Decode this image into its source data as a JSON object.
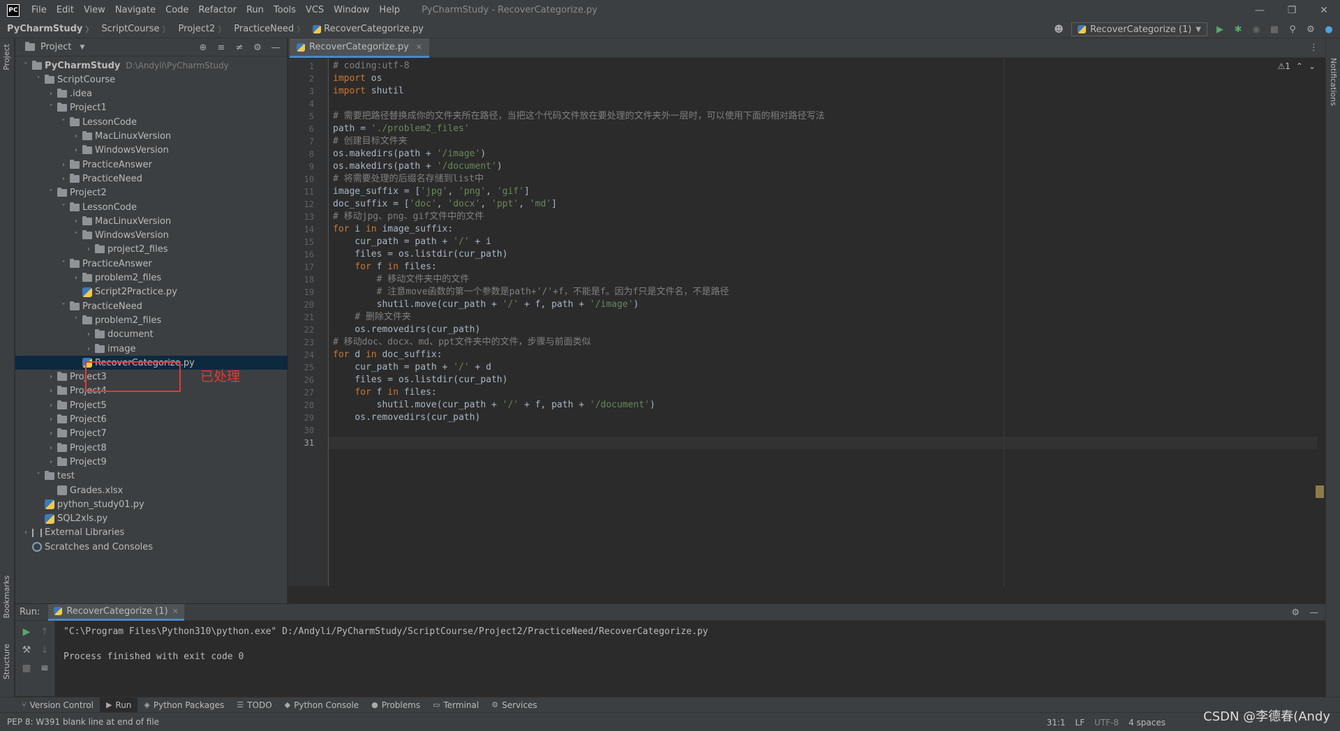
{
  "window": {
    "logo": "PC",
    "title": "PyCharmStudy - RecoverCategorize.py",
    "menu": [
      "File",
      "Edit",
      "View",
      "Navigate",
      "Code",
      "Refactor",
      "Run",
      "Tools",
      "VCS",
      "Window",
      "Help"
    ]
  },
  "breadcrumb": [
    "PyCharmStudy",
    "ScriptCourse",
    "Project2",
    "PracticeNeed",
    "RecoverCategorize.py"
  ],
  "run_config": "RecoverCategorize (1)",
  "stripes": {
    "project": "Project",
    "bookmarks": "Bookmarks",
    "structure": "Structure",
    "notifications": "Notifications"
  },
  "project_panel": {
    "title": "Project",
    "tree": [
      {
        "label": "PyCharmStudy",
        "hint": "D:\\Andyli\\PyCharmStudy",
        "depth": 0,
        "arrow": "open",
        "icon": "folder"
      },
      {
        "label": "ScriptCourse",
        "depth": 1,
        "arrow": "open",
        "icon": "folder"
      },
      {
        "label": ".idea",
        "depth": 2,
        "arrow": "closed",
        "icon": "folder"
      },
      {
        "label": "Project1",
        "depth": 2,
        "arrow": "open",
        "icon": "folder"
      },
      {
        "label": "LessonCode",
        "depth": 3,
        "arrow": "open",
        "icon": "folder"
      },
      {
        "label": "MacLinuxVersion",
        "depth": 4,
        "arrow": "closed",
        "icon": "folder"
      },
      {
        "label": "WindowsVersion",
        "depth": 4,
        "arrow": "closed",
        "icon": "folder"
      },
      {
        "label": "PracticeAnswer",
        "depth": 3,
        "arrow": "closed",
        "icon": "folder"
      },
      {
        "label": "PracticeNeed",
        "depth": 3,
        "arrow": "closed",
        "icon": "folder"
      },
      {
        "label": "Project2",
        "depth": 2,
        "arrow": "open",
        "icon": "folder"
      },
      {
        "label": "LessonCode",
        "depth": 3,
        "arrow": "open",
        "icon": "folder"
      },
      {
        "label": "MacLinuxVersion",
        "depth": 4,
        "arrow": "closed",
        "icon": "folder"
      },
      {
        "label": "WindowsVersion",
        "depth": 4,
        "arrow": "open",
        "icon": "folder"
      },
      {
        "label": "project2_files",
        "depth": 5,
        "arrow": "closed",
        "icon": "folder"
      },
      {
        "label": "PracticeAnswer",
        "depth": 3,
        "arrow": "open",
        "icon": "folder"
      },
      {
        "label": "problem2_files",
        "depth": 4,
        "arrow": "closed",
        "icon": "folder"
      },
      {
        "label": "Script2Practice.py",
        "depth": 4,
        "arrow": "none",
        "icon": "py"
      },
      {
        "label": "PracticeNeed",
        "depth": 3,
        "arrow": "open",
        "icon": "folder"
      },
      {
        "label": "problem2_files",
        "depth": 4,
        "arrow": "open",
        "icon": "folder"
      },
      {
        "label": "document",
        "depth": 5,
        "arrow": "closed",
        "icon": "folder"
      },
      {
        "label": "image",
        "depth": 5,
        "arrow": "closed",
        "icon": "folder"
      },
      {
        "label": "RecoverCategorize.py",
        "depth": 4,
        "arrow": "none",
        "icon": "py",
        "selected": true
      },
      {
        "label": "Project3",
        "depth": 2,
        "arrow": "closed",
        "icon": "folder"
      },
      {
        "label": "Project4",
        "depth": 2,
        "arrow": "closed",
        "icon": "folder"
      },
      {
        "label": "Project5",
        "depth": 2,
        "arrow": "closed",
        "icon": "folder"
      },
      {
        "label": "Project6",
        "depth": 2,
        "arrow": "closed",
        "icon": "folder"
      },
      {
        "label": "Project7",
        "depth": 2,
        "arrow": "closed",
        "icon": "folder"
      },
      {
        "label": "Project8",
        "depth": 2,
        "arrow": "closed",
        "icon": "folder"
      },
      {
        "label": "Project9",
        "depth": 2,
        "arrow": "closed",
        "icon": "folder"
      },
      {
        "label": "test",
        "depth": 1,
        "arrow": "open",
        "icon": "folder"
      },
      {
        "label": "Grades.xlsx",
        "depth": 2,
        "arrow": "none",
        "icon": "xls"
      },
      {
        "label": "python_study01.py",
        "depth": 1,
        "arrow": "none",
        "icon": "py"
      },
      {
        "label": "SQL2xls.py",
        "depth": 1,
        "arrow": "none",
        "icon": "py"
      },
      {
        "label": "External Libraries",
        "depth": 0,
        "arrow": "closed",
        "icon": "lib"
      },
      {
        "label": "Scratches and Consoles",
        "depth": 0,
        "arrow": "none",
        "icon": "scratch"
      }
    ],
    "annotation": "已处理"
  },
  "editor": {
    "tab_label": "RecoverCategorize.py",
    "inspection": "⚠1",
    "current_line": 31,
    "lines": [
      [
        [
          "cmt",
          "# coding:utf-8"
        ]
      ],
      [
        [
          "kw",
          "import"
        ],
        [
          "",
          " os"
        ]
      ],
      [
        [
          "kw",
          "import"
        ],
        [
          "",
          " shutil"
        ]
      ],
      [],
      [
        [
          "cmt",
          "# 需要把路径替换成你的文件夹所在路径，当把这个代码文件放在要处理的文件夹外一层时，可以使用下面的相对路径写法"
        ]
      ],
      [
        [
          "",
          "path = "
        ],
        [
          "str",
          "'./problem2_files'"
        ]
      ],
      [
        [
          "cmt",
          "# 创建目标文件夹"
        ]
      ],
      [
        [
          "",
          "os.makedirs(path + "
        ],
        [
          "str",
          "'/image'"
        ],
        [
          "",
          ")"
        ]
      ],
      [
        [
          "",
          "os.makedirs(path + "
        ],
        [
          "str",
          "'/document'"
        ],
        [
          "",
          ")"
        ]
      ],
      [
        [
          "cmt",
          "# 将需要处理的后缀名存储到list中"
        ]
      ],
      [
        [
          "",
          "image_suffix = ["
        ],
        [
          "str",
          "'jpg'"
        ],
        [
          "",
          ", "
        ],
        [
          "str",
          "'png'"
        ],
        [
          "",
          ", "
        ],
        [
          "str",
          "'gif'"
        ],
        [
          "",
          "]"
        ]
      ],
      [
        [
          "",
          "doc_suffix = ["
        ],
        [
          "str",
          "'doc'"
        ],
        [
          "",
          ", "
        ],
        [
          "str",
          "'docx'"
        ],
        [
          "",
          ", "
        ],
        [
          "str",
          "'ppt'"
        ],
        [
          "",
          ", "
        ],
        [
          "str",
          "'md'"
        ],
        [
          "",
          "]"
        ]
      ],
      [
        [
          "cmt",
          "# 移动jpg、png、gif文件中的文件"
        ]
      ],
      [
        [
          "kw",
          "for"
        ],
        [
          "",
          " i "
        ],
        [
          "kw",
          "in"
        ],
        [
          "",
          " image_suffix:"
        ]
      ],
      [
        [
          "",
          "    cur_path = path + "
        ],
        [
          "str",
          "'/'"
        ],
        [
          "",
          " + i"
        ]
      ],
      [
        [
          "",
          "    files = os.listdir(cur_path)"
        ]
      ],
      [
        [
          "",
          "    "
        ],
        [
          "kw",
          "for"
        ],
        [
          "",
          " f "
        ],
        [
          "kw",
          "in"
        ],
        [
          "",
          " files:"
        ]
      ],
      [
        [
          "cmt",
          "        # 移动文件夹中的文件"
        ]
      ],
      [
        [
          "cmt",
          "        # 注意move函数的第一个参数是path+'/'+f，不能是f。因为f只是文件名，不是路径"
        ]
      ],
      [
        [
          "",
          "        shutil.move(cur_path + "
        ],
        [
          "str",
          "'/'"
        ],
        [
          "",
          " + f, path + "
        ],
        [
          "str",
          "'/image'"
        ],
        [
          "",
          ")"
        ]
      ],
      [
        [
          "cmt",
          "    # 删除文件夹"
        ]
      ],
      [
        [
          "",
          "    os.removedirs(cur_path)"
        ]
      ],
      [
        [
          "cmt",
          "# 移动doc、docx、md、ppt文件夹中的文件，步骤与前面类似"
        ]
      ],
      [
        [
          "kw",
          "for"
        ],
        [
          "",
          " d "
        ],
        [
          "kw",
          "in"
        ],
        [
          "",
          " doc_suffix:"
        ]
      ],
      [
        [
          "",
          "    cur_path = path + "
        ],
        [
          "str",
          "'/'"
        ],
        [
          "",
          " + d"
        ]
      ],
      [
        [
          "",
          "    files = os.listdir(cur_path)"
        ]
      ],
      [
        [
          "",
          "    "
        ],
        [
          "kw",
          "for"
        ],
        [
          "",
          " f "
        ],
        [
          "kw",
          "in"
        ],
        [
          "",
          " files:"
        ]
      ],
      [
        [
          "",
          "        shutil.move(cur_path + "
        ],
        [
          "str",
          "'/'"
        ],
        [
          "",
          " + f, path + "
        ],
        [
          "str",
          "'/document'"
        ],
        [
          "",
          ")"
        ]
      ],
      [
        [
          "",
          "    os.removedirs(cur_path)"
        ]
      ],
      [],
      []
    ]
  },
  "run_panel": {
    "label": "Run:",
    "tab": "RecoverCategorize (1)",
    "console": [
      "\"C:\\Program Files\\Python310\\python.exe\" D:/Andyli/PyCharmStudy/ScriptCourse/Project2/PracticeNeed/RecoverCategorize.py",
      "",
      "Process finished with exit code 0"
    ]
  },
  "bottom_tabs": [
    {
      "label": "Version Control",
      "icon": "⑂"
    },
    {
      "label": "Run",
      "icon": "▶",
      "active": true
    },
    {
      "label": "Python Packages",
      "icon": "◈"
    },
    {
      "label": "TODO",
      "icon": "☰"
    },
    {
      "label": "Python Console",
      "icon": "◆"
    },
    {
      "label": "Problems",
      "icon": "●"
    },
    {
      "label": "Terminal",
      "icon": "▭"
    },
    {
      "label": "Services",
      "icon": "⚙"
    }
  ],
  "status": {
    "message": "PEP 8: W391 blank line at end of file",
    "position": "31:1",
    "line_sep": "LF",
    "encoding": "UTF-8",
    "indent": "4 spaces",
    "watermark": "CSDN @李德春(Andy"
  }
}
